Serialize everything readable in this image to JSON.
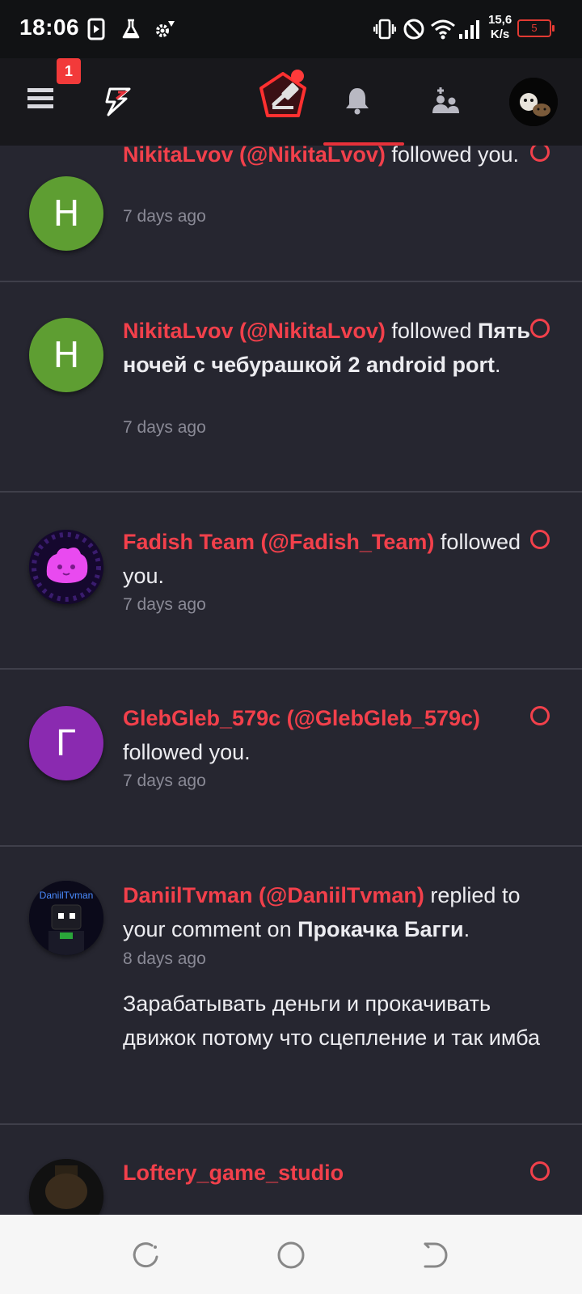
{
  "status_bar": {
    "time": "18:06",
    "speed_line1": "15,6",
    "speed_line2": "K/s",
    "battery": "5"
  },
  "header": {
    "menu_badge": "1"
  },
  "notifications": [
    {
      "avatar_letter": "Н",
      "avatar_color": "#5e9e32",
      "user": "NikitaLvov (@NikitaLvov)",
      "action": " followed you.",
      "time": "7 days ago",
      "unread": true
    },
    {
      "avatar_letter": "Н",
      "avatar_color": "#5e9e32",
      "user": "NikitaLvov (@NikitaLvov)",
      "action": " followed ",
      "target": "Пять ночей с чебурашкой 2 android port",
      "suffix": ".",
      "time": "7 days ago",
      "unread": true
    },
    {
      "avatar_image": "fadish-team-avatar",
      "user": "Fadish Team (@Fadish_Team)",
      "action": " followed you.",
      "time": "7 days ago",
      "unread": true
    },
    {
      "avatar_letter": "Г",
      "avatar_color": "#8a2ab0",
      "user": "GlebGleb_579c (@GlebGleb_579c)",
      "action": " followed you.",
      "time": "7 days ago",
      "unread": true
    },
    {
      "avatar_image": "daniiltvman-avatar",
      "avatar_caption": "DaniilTvman",
      "user": "DaniilTvman (@DaniilTvman)",
      "action": " replied to your comment on ",
      "target": "Прокачка Багги",
      "suffix": ".",
      "time": "8 days ago",
      "body": "Зарабатывать деньги и прокачивать движок потому что сцепление и так имба",
      "unread": false
    },
    {
      "avatar_image": "loftery-avatar",
      "user": "Loftery_game_studio",
      "unread": true
    }
  ],
  "colors": {
    "accent": "#f2404b",
    "background": "#262630",
    "header": "#18181c"
  }
}
